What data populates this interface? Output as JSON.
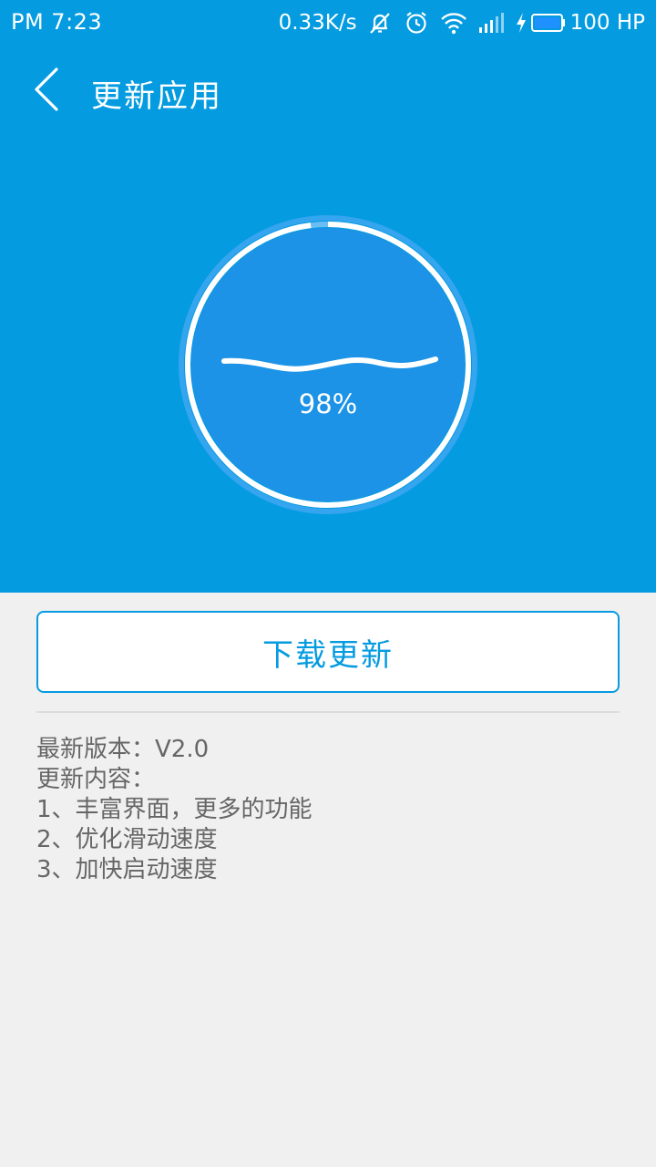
{
  "status_bar": {
    "time": "PM 7:23",
    "net_speed": "0.33K/s",
    "battery_text": "100 HP",
    "icons": [
      "mute-icon",
      "alarm-icon",
      "wifi-icon",
      "signal-icon",
      "charging-icon",
      "battery-icon"
    ]
  },
  "toolbar": {
    "title": "更新应用",
    "back_icon": "chevron-left-icon"
  },
  "progress": {
    "percent_label": "98%",
    "value": 0.98
  },
  "actions": {
    "download_label": "下载更新"
  },
  "release_notes": {
    "version_line": "最新版本：V2.0",
    "content_heading": "更新内容：",
    "items": [
      "1、丰富界面，更多的功能",
      "2、优化滑动速度",
      "3、加快启动速度"
    ]
  },
  "colors": {
    "primary": "#049be0",
    "background": "#f0f0f0",
    "text_secondary": "#666666"
  }
}
